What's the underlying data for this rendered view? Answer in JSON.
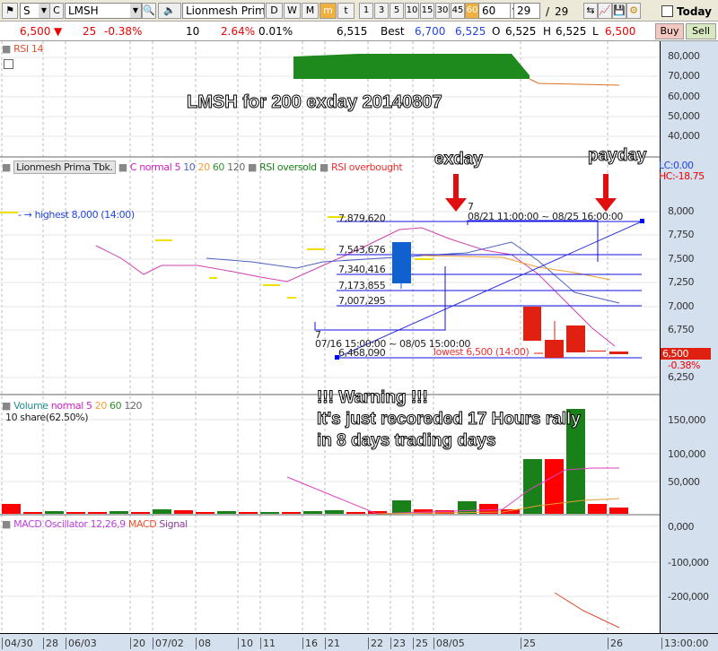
{
  "toolbar": {
    "market": "S",
    "type": "C",
    "symbol": "LMSH",
    "name": "Lionmesh Prima",
    "periods": [
      "D",
      "W",
      "M",
      "m",
      "t"
    ],
    "active_period": "m",
    "minutes": [
      "1",
      "3",
      "5",
      "10",
      "15",
      "30",
      "45",
      "60"
    ],
    "active_minute": "60",
    "interval_value": "60",
    "count": "29",
    "count_sep": "/",
    "count_total": "29",
    "today_label": "Today"
  },
  "quote": {
    "price": "6,500",
    "change": "25",
    "change_pct": "-0.38%",
    "volume": "10",
    "vol_pct": "2.64%",
    "turnover_pct": "0.01%",
    "prev": "6,515",
    "best_label": "Best",
    "best_ask": "6,700",
    "best_bid": "6,525",
    "open_label": "O",
    "open": "6,525",
    "high_label": "H",
    "high": "6,525",
    "low_label": "L",
    "low": "6,500",
    "buy": "Buy",
    "sell": "Sell"
  },
  "rsi_panel": {
    "title": "RSI 14",
    "ticks": [
      "80,000",
      "70,000",
      "60,000",
      "50,000",
      "40,000"
    ]
  },
  "price_panel": {
    "stock": "Lionmesh Prima Tbk.",
    "ma_label": "C normal",
    "ma": [
      "5",
      "10",
      "20",
      "60",
      "120"
    ],
    "oversold": "RSI oversold",
    "overbought": "RSI overbought",
    "lc": "LC:0.00",
    "hc": "HC:-18.75",
    "ticks": [
      "8,000",
      "7,750",
      "7,500",
      "7,250",
      "7,000",
      "6,750",
      "6,250"
    ],
    "current": "6,500",
    "current_pct": "-0.38%",
    "highest": "highest 8,000 (14:00)",
    "lowest": "lowest 6,500 (14:00)",
    "fib": [
      "7,879,620",
      "7,543,676",
      "7,340,416",
      "7,173,855",
      "7,007,295",
      "6,468,090"
    ],
    "range1_n": "7",
    "range1": "08/21 11:00:00 ~ 08/25 16:00:00",
    "range2_n": "7",
    "range2": "07/16 15:00:00 ~ 08/05 15:00:00"
  },
  "volume_panel": {
    "title": "Volume",
    "ma_label": "normal",
    "ma": [
      "5",
      "20",
      "60",
      "120"
    ],
    "sub": "10 share(62.50%)",
    "ticks": [
      "150,000",
      "100,000",
      "50,000"
    ]
  },
  "macd_panel": {
    "title": "MACD Oscillator 12,26,9",
    "macd": "MACD",
    "signal": "Signal",
    "ticks": [
      "0,000",
      "-100,000",
      "-200,000"
    ]
  },
  "annotations": {
    "headline": "LMSH for 200 exday 20140807",
    "exday": "exday",
    "payday": "payday",
    "warning1": "!!! Warning !!!",
    "warning2": "It's just recoreded 17 Hours rally",
    "warning3": "in 8 days trading days"
  },
  "xaxis": {
    "labels": [
      "04/30",
      "28",
      "06/03",
      "20",
      "07/02",
      "08",
      "10",
      "11",
      "16",
      "21",
      "22",
      "23",
      "25",
      "08/05",
      "25",
      "26"
    ],
    "time": "13:00:00"
  }
}
